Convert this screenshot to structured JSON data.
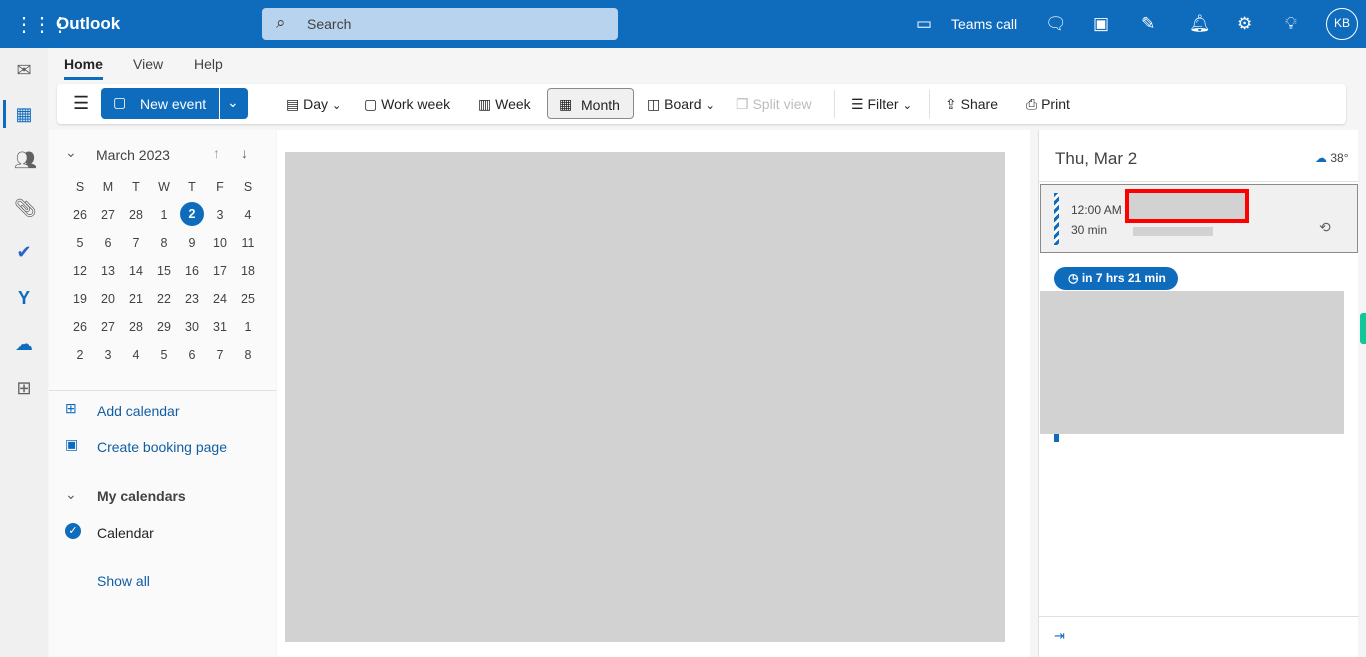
{
  "header": {
    "app": "Outlook",
    "search_placeholder": "Search",
    "teams_call": "Teams call",
    "avatar": "KB"
  },
  "tabs": [
    "Home",
    "View",
    "Help"
  ],
  "toolbar": {
    "new_event": "New event",
    "day": "Day",
    "work_week": "Work week",
    "week": "Week",
    "month": "Month",
    "board": "Board",
    "split_view": "Split view",
    "filter": "Filter",
    "share": "Share",
    "print": "Print"
  },
  "mini_calendar": {
    "title": "March 2023",
    "weekdays": [
      "S",
      "M",
      "T",
      "W",
      "T",
      "F",
      "S"
    ],
    "weeks": [
      [
        "26",
        "27",
        "28",
        "1",
        "2",
        "3",
        "4"
      ],
      [
        "5",
        "6",
        "7",
        "8",
        "9",
        "10",
        "11"
      ],
      [
        "12",
        "13",
        "14",
        "15",
        "16",
        "17",
        "18"
      ],
      [
        "19",
        "20",
        "21",
        "22",
        "23",
        "24",
        "25"
      ],
      [
        "26",
        "27",
        "28",
        "29",
        "30",
        "31",
        "1"
      ],
      [
        "2",
        "3",
        "4",
        "5",
        "6",
        "7",
        "8"
      ]
    ],
    "selected": "2"
  },
  "left": {
    "add_calendar": "Add calendar",
    "create_booking": "Create booking page",
    "my_calendars": "My calendars",
    "calendar": "Calendar",
    "show_all": "Show all"
  },
  "agenda": {
    "date": "Thu, Mar 2",
    "weather": "38°",
    "event_time": "12:00 AM",
    "event_duration": "30 min",
    "countdown": "in 7 hrs 21 min"
  },
  "colors": {
    "brand": "#0f6cbd",
    "highlight": "#ff0000"
  }
}
